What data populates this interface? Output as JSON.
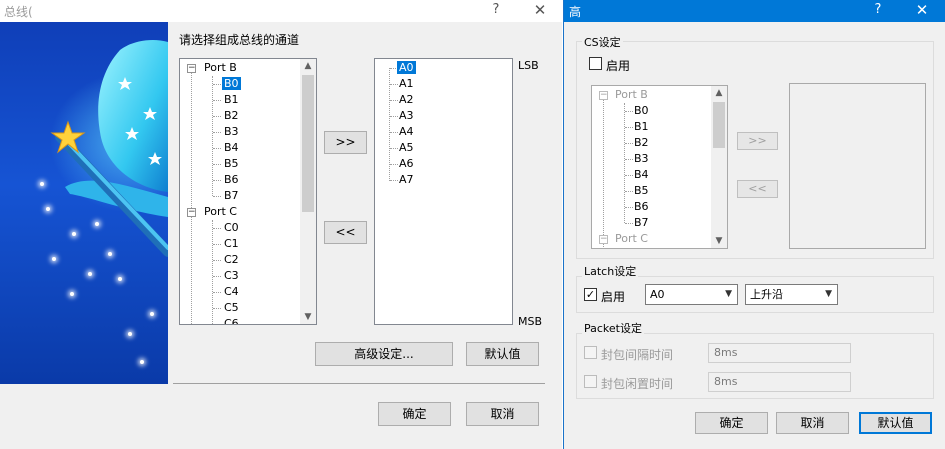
{
  "back_dialog": {
    "title": "总线(",
    "help_glyph": "?",
    "close_glyph": "✕",
    "prompt": "请选择组成总线的通道",
    "tree": {
      "port_b": "Port B",
      "b_channels": [
        "B0",
        "B1",
        "B2",
        "B3",
        "B4",
        "B5",
        "B6",
        "B7"
      ],
      "port_c": "Port C",
      "c_channels": [
        "C0",
        "C1",
        "C2",
        "C3",
        "C4",
        "C5",
        "C6"
      ]
    },
    "selected_channels": [
      "A0",
      "A1",
      "A2",
      "A3",
      "A4",
      "A5",
      "A6",
      "A7"
    ],
    "add_button": ">>",
    "remove_button": "<<",
    "lsb_label": "LSB",
    "msb_label": "MSB",
    "advanced_button": "高级设定...",
    "default_button": "默认值",
    "ok_button": "确定",
    "cancel_button": "取消"
  },
  "front_dialog": {
    "title": "高",
    "help_glyph": "?",
    "close_glyph": "✕",
    "cs_group": {
      "label": "CS设定",
      "enable_label": "启用",
      "enable_checked": false,
      "port_b": "Port B",
      "channels": [
        "B0",
        "B1",
        "B2",
        "B3",
        "B4",
        "B5",
        "B6",
        "B7"
      ],
      "port_c": "Port C",
      "add_button": ">>",
      "remove_button": "<<"
    },
    "latch_group": {
      "label": "Latch设定",
      "enable_label": "启用",
      "enable_checked": true,
      "channel_value": "A0",
      "edge_value": "上升沿"
    },
    "packet_group": {
      "label": "Packet设定",
      "interval_label": "封包间隔时间",
      "interval_value": "8ms",
      "idle_label": "封包闲置时间",
      "idle_value": "8ms"
    },
    "ok_button": "确定",
    "cancel_button": "取消",
    "default_button": "默认值"
  },
  "colors": {
    "accent": "#0078d7",
    "dialog_bg": "#f0f0f0",
    "wizard_bg": "#1654d4"
  }
}
